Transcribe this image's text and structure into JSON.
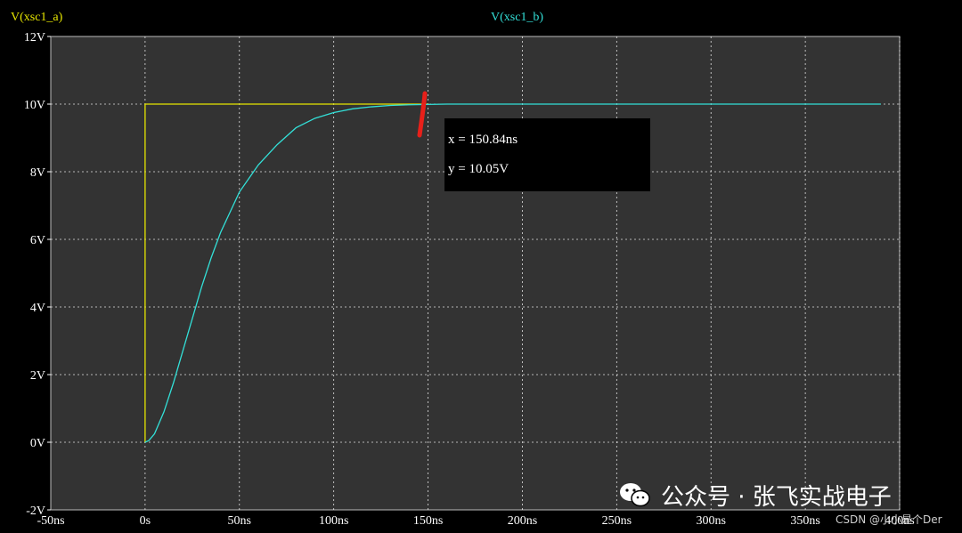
{
  "chart_data": {
    "type": "line",
    "legend": [
      {
        "name": "V(xsc1_a)",
        "color": "#e6e600"
      },
      {
        "name": "V(xsc1_b)",
        "color": "#33e0d8"
      }
    ],
    "x_ticks": [
      "-50ns",
      "0s",
      "50ns",
      "100ns",
      "150ns",
      "200ns",
      "250ns",
      "300ns",
      "350ns",
      "400ns"
    ],
    "y_ticks": [
      "12V",
      "10V",
      "8V",
      "6V",
      "4V",
      "2V",
      "0V",
      "-2V"
    ],
    "xlim": [
      -50,
      400
    ],
    "ylim": [
      -2,
      12
    ],
    "x_unit": "ns",
    "grid": true,
    "series": [
      {
        "name": "V(xsc1_a)",
        "color": "#e6e600",
        "x": [
          0,
          0,
          150
        ],
        "y": [
          0,
          10,
          10
        ]
      },
      {
        "name": "V(xsc1_b)",
        "color": "#33e0d8",
        "x": [
          0,
          2,
          5,
          10,
          15,
          20,
          25,
          30,
          35,
          40,
          50,
          60,
          70,
          80,
          90,
          100,
          110,
          120,
          130,
          140,
          150,
          160,
          180,
          200,
          250,
          300,
          350,
          390
        ],
        "y": [
          0,
          0.05,
          0.25,
          0.9,
          1.75,
          2.7,
          3.65,
          4.6,
          5.45,
          6.2,
          7.4,
          8.2,
          8.8,
          9.3,
          9.58,
          9.75,
          9.86,
          9.92,
          9.96,
          9.98,
          9.99,
          10.0,
          10.0,
          10.0,
          10.0,
          10.0,
          10.0,
          10.0
        ]
      }
    ]
  },
  "cursor_readout": {
    "x_text": "x = 150.84ns",
    "y_text": "y = 10.05V"
  },
  "watermark": {
    "icon": "wechat-icon",
    "text": "公众号 · 张飞实战电子",
    "csdn": "CSDN @小小是个Der"
  },
  "colors": {
    "plot_bg": "#333333",
    "page_bg": "#000000",
    "grid": "#ffffff",
    "cursor_mark": "#e8201a"
  }
}
